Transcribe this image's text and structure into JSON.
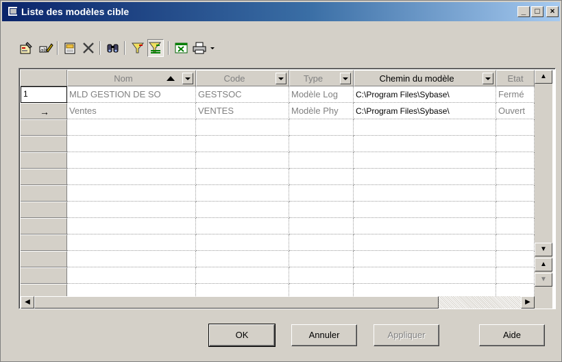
{
  "window": {
    "title": "Liste des modèles cible",
    "controls": {
      "minimize": "_",
      "maximize": "□",
      "close": "×"
    }
  },
  "toolbar": {
    "buttons": [
      {
        "name": "properties-icon"
      },
      {
        "name": "rename-icon"
      },
      {
        "name": "open-model-icon"
      },
      {
        "name": "delete-icon"
      },
      {
        "name": "find-icon"
      },
      {
        "name": "filter-icon"
      },
      {
        "name": "apply-filter-icon",
        "pressed": true
      },
      {
        "name": "export-excel-icon"
      },
      {
        "name": "print-icon"
      },
      {
        "name": "dropdown-icon"
      }
    ]
  },
  "grid": {
    "columns": [
      {
        "label": "Nom",
        "sorted": "asc",
        "active": false
      },
      {
        "label": "Code",
        "active": false
      },
      {
        "label": "Type",
        "active": false
      },
      {
        "label": "Chemin du modèle",
        "active": true
      },
      {
        "label": "Etat",
        "active": false
      }
    ],
    "rows": [
      {
        "header": "1",
        "cells": [
          "MLD GESTION DE SO",
          "GESTSOC",
          "Modèle Log",
          "C:\\Program Files\\Sybase\\",
          "Fermé"
        ]
      },
      {
        "header": "→",
        "cells": [
          "Ventes",
          "VENTES",
          "Modèle Phy",
          "C:\\Program Files\\Sybase\\",
          "Ouvert"
        ]
      }
    ],
    "empty_rows": 11
  },
  "buttons": {
    "ok": "OK",
    "cancel": "Annuler",
    "apply": "Appliquer",
    "help": "Aide"
  },
  "colors": {
    "title_start": "#0a246a",
    "title_end": "#a6caf0",
    "face": "#d4d0c8",
    "inactive_text": "#808080"
  }
}
